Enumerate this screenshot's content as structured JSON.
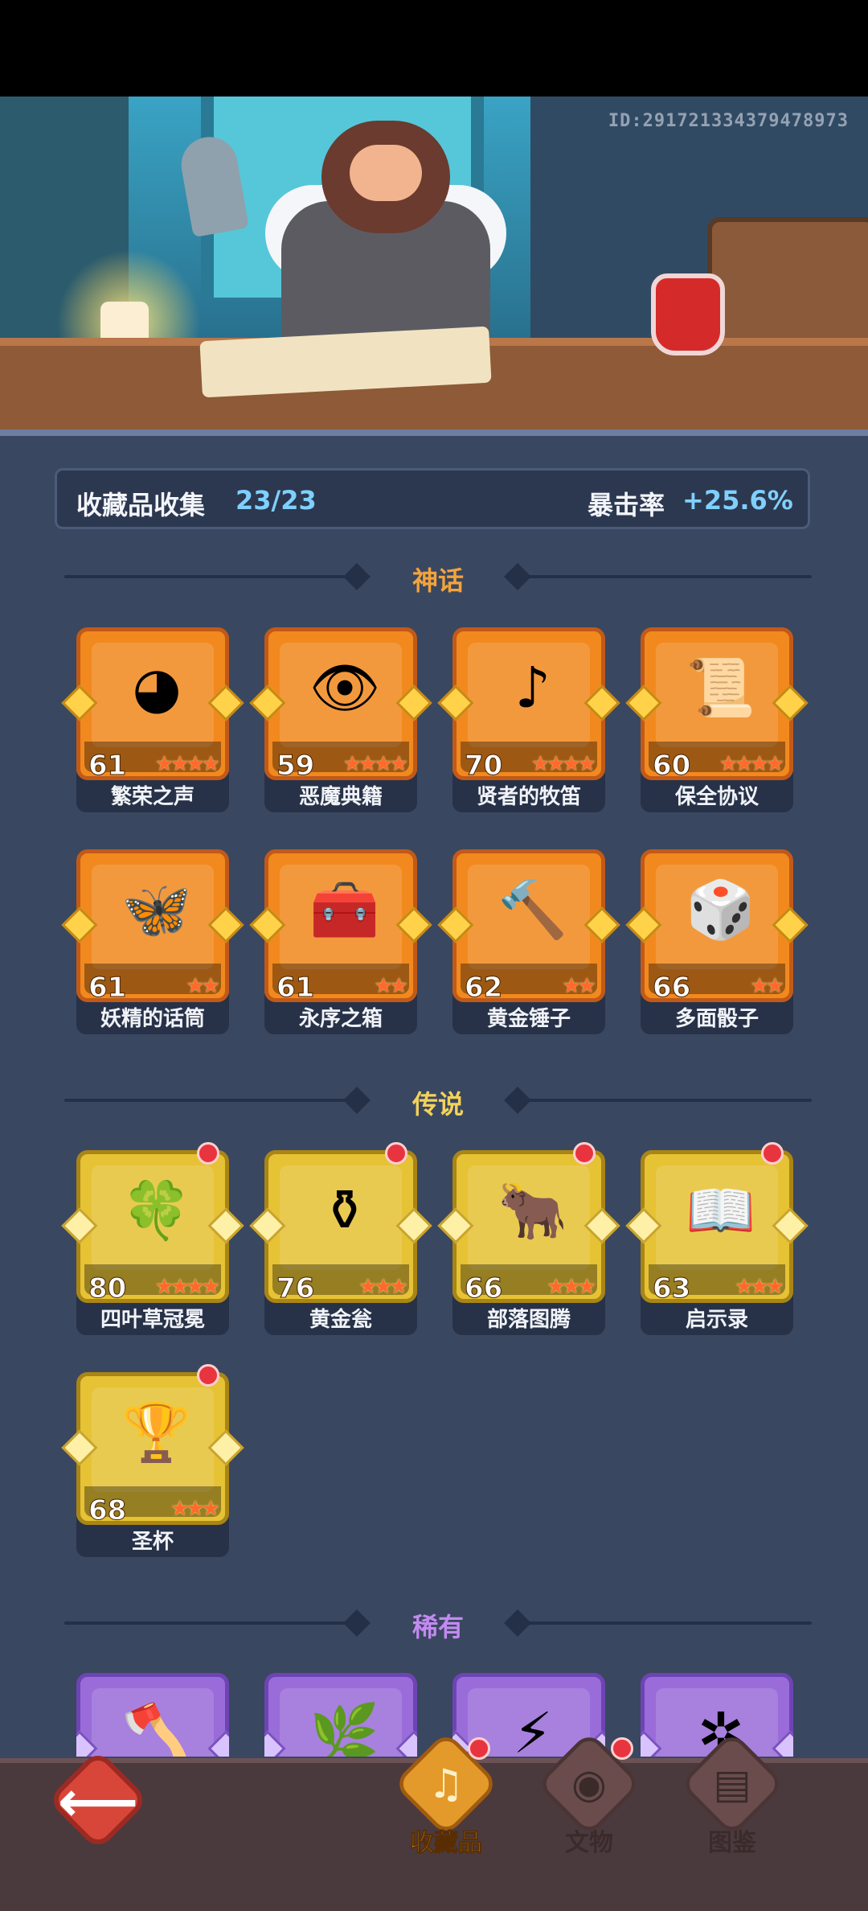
{
  "header": {
    "user_id": "ID:29172133437947897З"
  },
  "summary": {
    "collection_label": "收藏品收集",
    "collection_count": "23/23",
    "crit_label": "暴击率",
    "crit_value": "+25.6%"
  },
  "sections": {
    "mythic": {
      "title": "神话",
      "color": "#f4a33a"
    },
    "legend": {
      "title": "传说",
      "color": "#f2d25a"
    },
    "rare": {
      "title": "稀有",
      "color": "#c28af0"
    }
  },
  "mythic_items": [
    {
      "name": "繁荣之声",
      "level": "61",
      "stars": "★★★★",
      "icon": "blue-spirit-icon"
    },
    {
      "name": "恶魔典籍",
      "level": "59",
      "stars": "★★★★",
      "icon": "demon-tome-icon"
    },
    {
      "name": "贤者的牧笛",
      "level": "70",
      "stars": "★★★★",
      "icon": "flute-icon"
    },
    {
      "name": "保全协议",
      "level": "60",
      "stars": "★★★★",
      "icon": "contract-scroll-icon"
    },
    {
      "name": "妖精的话筒",
      "level": "61",
      "stars": "★★",
      "icon": "fairy-mic-icon"
    },
    {
      "name": "永序之箱",
      "level": "61",
      "stars": "★★",
      "icon": "treasure-chest-icon"
    },
    {
      "name": "黄金锤子",
      "level": "62",
      "stars": "★★",
      "icon": "golden-hammer-icon"
    },
    {
      "name": "多面骰子",
      "level": "66",
      "stars": "★★",
      "icon": "dice-icon"
    }
  ],
  "legend_items": [
    {
      "name": "四叶草冠冕",
      "level": "80",
      "stars": "★★★★",
      "icon": "clover-crown-icon"
    },
    {
      "name": "黄金瓮",
      "level": "76",
      "stars": "★★★",
      "icon": "golden-urn-icon"
    },
    {
      "name": "部落图腾",
      "level": "66",
      "stars": "★★★",
      "icon": "tribal-totem-icon"
    },
    {
      "name": "启示录",
      "level": "63",
      "stars": "★★★",
      "icon": "open-book-icon"
    },
    {
      "name": "圣杯",
      "level": "68",
      "stars": "★★★",
      "icon": "grail-icon"
    }
  ],
  "rare_items": [
    {
      "icon": "axe-icon",
      "glyph": "🪓"
    },
    {
      "icon": "thorn-wreath-icon",
      "glyph": "🌿"
    },
    {
      "icon": "lightning-gem-icon",
      "glyph": "⚡"
    },
    {
      "icon": "skull-antler-icon",
      "glyph": "✲"
    }
  ],
  "nav": {
    "back_label": "⟵",
    "tabs": [
      {
        "label": "收藏品",
        "icon": "harp-icon",
        "glyph": "♫"
      },
      {
        "label": "文物",
        "icon": "eye-icon",
        "glyph": "◉"
      },
      {
        "label": "图鉴",
        "icon": "book-icon",
        "glyph": "▤"
      }
    ]
  }
}
